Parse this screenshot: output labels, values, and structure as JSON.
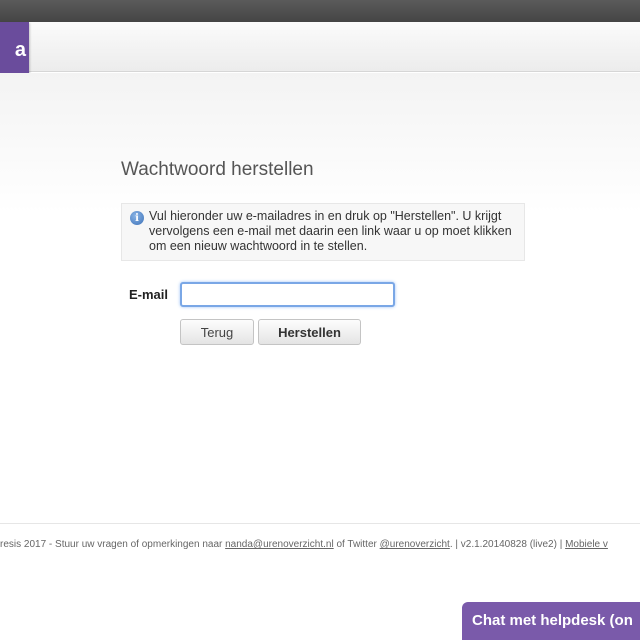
{
  "logo": {
    "text": "a"
  },
  "page": {
    "title": "Wachtwoord herstellen"
  },
  "info": {
    "icon": "info-icon",
    "icon_glyph": "i",
    "text": "Vul hieronder uw e-mailadres in en druk op \"Herstellen\". U krijgt vervolgens een e-mail met daarin een link waar u op moet klikken om een nieuw wachtwoord in te stellen."
  },
  "form": {
    "email_label": "E-mail",
    "email_value": "",
    "back_label": "Terug",
    "reset_label": "Herstellen"
  },
  "footer": {
    "prefix": "resis 2017 - Stuur uw vragen of opmerkingen naar ",
    "email_link": "nanda@urenoverzicht.nl",
    "middle": " of Twitter ",
    "twitter_link": "@urenoverzicht",
    "suffix": ".  |  v2.1.20140828 (live2)  |  ",
    "mobile_link": "Mobiele v"
  },
  "chat": {
    "label": "Chat met helpdesk (on"
  },
  "colors": {
    "brand": "#6a4c9c",
    "chat": "#7a5aaa",
    "focus": "#7aa7e6"
  }
}
